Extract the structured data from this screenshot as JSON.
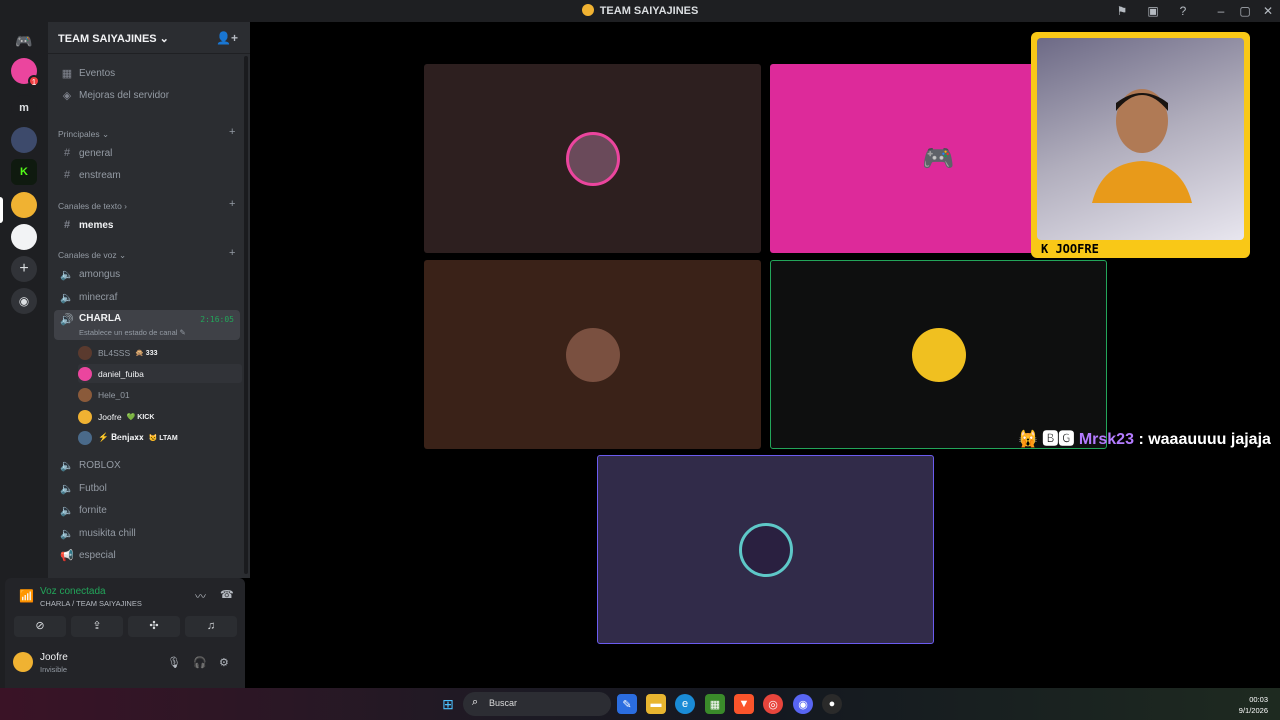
{
  "window": {
    "title": "TEAM SAIYAJINES"
  },
  "server": {
    "name": "TEAM SAIYAJINES"
  },
  "sidebar": {
    "top_items": [
      {
        "label": "Eventos",
        "icon": "calendar-icon"
      },
      {
        "label": "Mejoras del servidor",
        "icon": "boost-icon"
      }
    ],
    "categories": {
      "principales": "Principales",
      "texto": "Canales de texto",
      "voz": "Canales de voz"
    },
    "text_channels_principales": [
      "general",
      "enstream"
    ],
    "text_channels": [
      "memes"
    ],
    "voice_channels_before": [
      "amongus",
      "minecraf"
    ],
    "active_voice": {
      "name": "CHARLA",
      "timer": "2:16:05",
      "status_hint": "Establece un estado de canal"
    },
    "members": [
      {
        "name": "BL4SSS",
        "tag": "🙊 333",
        "avatar_color": "#5a3a2e"
      },
      {
        "name": "daniel_fuiba",
        "tag": "",
        "avatar_color": "#eb459e"
      },
      {
        "name": "Hele_01",
        "tag": "",
        "avatar_color": "#8a5a3a"
      },
      {
        "name": "Joofre",
        "tag": "💚 KICK",
        "avatar_color": "#f0b232"
      },
      {
        "name": "⚡ 𝐁𝐞𝐧𝐣𝐚𝐱𝐱",
        "tag": "😼 LTAM",
        "avatar_color": "#4a6a8a"
      }
    ],
    "voice_channels_after": [
      "ROBLOX",
      "Futbol",
      "fornite",
      "musikita chill",
      "especial"
    ]
  },
  "voice_panel": {
    "status": "Voz conectada",
    "location": "CHARLA / TEAM SAIYAJINES"
  },
  "user": {
    "name": "Joofre",
    "status": "Invisible"
  },
  "stage": {
    "webcam_label": "K JOOFRE",
    "chat": {
      "user": "Mrsk23",
      "message": ": waaauuuu jajaja",
      "badge": "🙀 🅱🅶"
    }
  },
  "taskbar": {
    "search_placeholder": "Buscar",
    "time": "00:03",
    "date": "9/1/2026"
  },
  "colors": {
    "tile1": "#2d1f1f",
    "tile2": "#dd2a9a",
    "tile3": "#3a2218",
    "tile4": "#0e0f0f",
    "tile5": "#312b49",
    "speaking": "#23a55a",
    "webcam_border": "#f9c817"
  }
}
